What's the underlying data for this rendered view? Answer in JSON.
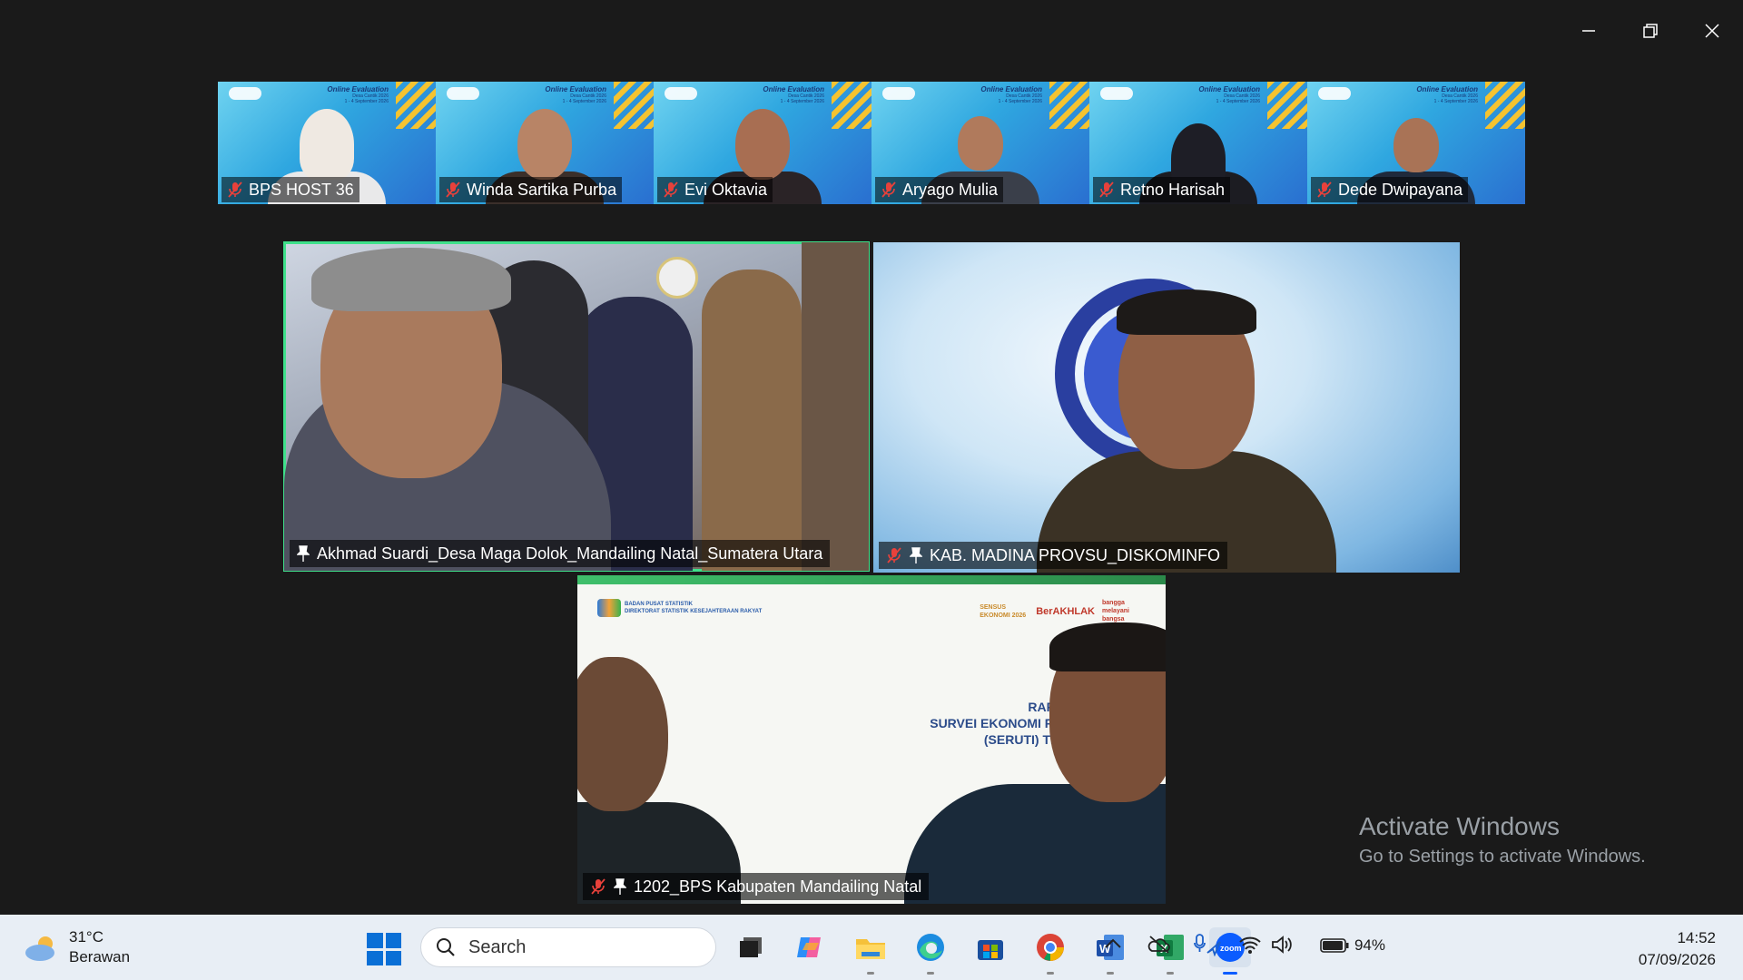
{
  "window_controls": {
    "minimize": "minimize",
    "restore": "restore",
    "close": "close"
  },
  "strip": {
    "event_title": "Online Evaluation",
    "event_sub": "Desa Cantik 2026",
    "event_date": "1 - 4 September 2026",
    "participants": [
      {
        "name": "BPS HOST 36"
      },
      {
        "name": "Winda Sartika Purba"
      },
      {
        "name": "Evi Oktavia"
      },
      {
        "name": "Aryago Mulia"
      },
      {
        "name": "Retno Harisah"
      },
      {
        "name": "Dede Dwipayana"
      }
    ]
  },
  "tiles": [
    {
      "name": "Akhmad Suardi_Desa Maga Dolok_Mandailing Natal_Sumatera Utara",
      "active": true
    },
    {
      "name": "KAB. MADINA PROVSU_DISKOMINFO"
    },
    {
      "name": "1202_BPS Kabupaten Mandailing Natal"
    }
  ],
  "slide": {
    "org1": "BADAN PUSAT STATISTIK",
    "org2": "DIREKTORAT STATISTIK KESEJAHTERAAN RAKYAT",
    "logo1": "SENSUS EKONOMI 2026",
    "logo2": "BerAKHLAK",
    "logo3": "bangga melayani bangsa",
    "line1": "RAPA",
    "line2": "SURVEI EKONOMI RU",
    "line3": "(SERUTI) TRI"
  },
  "watermark": {
    "title": "Activate Windows",
    "subtitle": "Go to Settings to activate Windows."
  },
  "taskbar": {
    "temperature": "31°C",
    "weather": "Berawan",
    "search_placeholder": "Search",
    "battery": "94%",
    "time": "14:52",
    "date": "07/09/2026"
  },
  "colors": {
    "active_speaker": "#3fe08a",
    "muted": "#e8413b",
    "zoom": "#0b5cff"
  }
}
